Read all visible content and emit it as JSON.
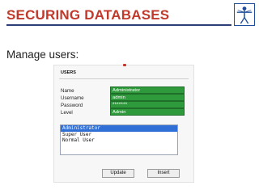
{
  "slide": {
    "title": "SECURING DATABASES",
    "subtitle": "Manage users:"
  },
  "colors": {
    "title": "#c0392b",
    "field_fill": "#2f9a3c",
    "list_selection": "#2f6fd6"
  },
  "logo": {
    "icon": "vitruvian-figure-icon"
  },
  "panel": {
    "header": "USERS",
    "fields": [
      {
        "label": "Name",
        "value": "Administrator"
      },
      {
        "label": "Username",
        "value": "admin"
      },
      {
        "label": "Password",
        "value": "*******"
      },
      {
        "label": "Level",
        "value": "Admin"
      }
    ],
    "users": [
      "Administrator",
      "Super User",
      "Normal User"
    ],
    "selected_user": "Administrator",
    "buttons": {
      "update": "Update",
      "insert": "Insert"
    }
  }
}
